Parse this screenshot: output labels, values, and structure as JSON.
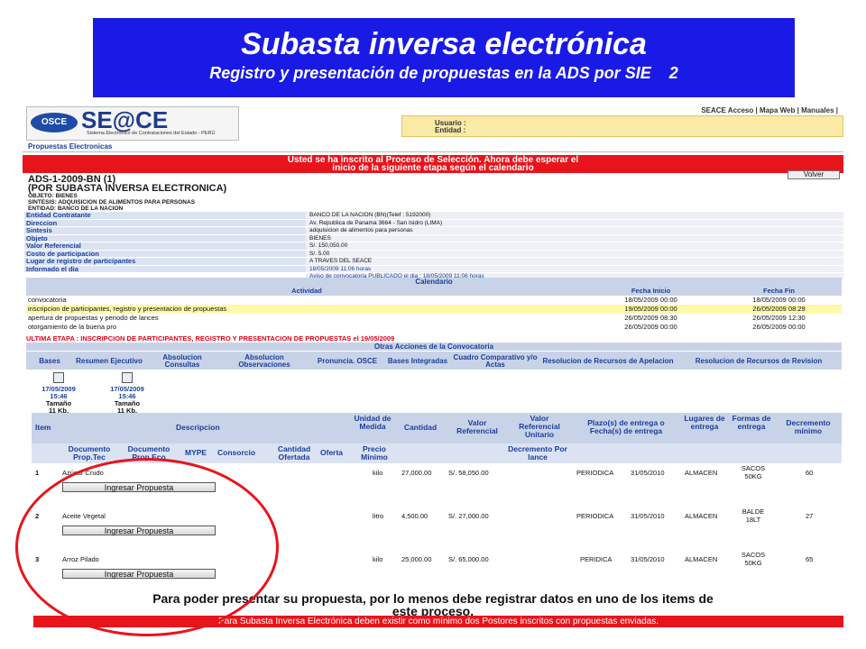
{
  "banner": {
    "title": "Subasta inversa electrónica",
    "subtitle": "Registro y presentación de propuestas en la ADS por SIE",
    "slide_number": "2"
  },
  "app": {
    "logo_badge": "OSCE",
    "brand": "SE@CE",
    "brand_sub": "Sistema Electrónico de Contrataciones del Estado - PERÚ",
    "nav": [
      "SEACE Acceso",
      "Mapa Web",
      "Manuales"
    ],
    "user_label": "Usuario :",
    "entity_label": "Entidad :",
    "tab": "Propuestas Electronicas"
  },
  "alert": {
    "line1": "Usted se ha inscrito al Proceso de Selección. Ahora debe esperar el",
    "line2": "inicio de la siguiente etapa según el calendario"
  },
  "volver": "Volver",
  "process": {
    "code": "ADS-1-2009-BN (1)",
    "type": "(POR SUBASTA INVERSA ELECTRONICA)",
    "objeto": "OBJETO: BIENES",
    "sintesis": "SINTESIS: ADQUISICION DE ALIMENTOS PARA PERSONAS",
    "entidad": "ENTIDAD: BANCO DE LA NACION"
  },
  "info": [
    {
      "k": "Entidad Contratante",
      "v": "BANCO DE LA NACION (BN)(Telef : 5192000)"
    },
    {
      "k": "Direccion",
      "v": "Av. Republica de Panama 3664 - San Isidro (LIMA)"
    },
    {
      "k": "Sintesis",
      "v": "adquisicion de alimentos para personas"
    },
    {
      "k": "Objeto",
      "v": "BIENES"
    },
    {
      "k": "Valor Referencial",
      "v": "S/. 150,050.00"
    },
    {
      "k": "Costo de participacion",
      "v": "S/. 5.00"
    },
    {
      "k": "Lugar de registro de participantes",
      "v": "A TRAVES DEL SEACE"
    },
    {
      "k": "Informado el dia",
      "v": "18/05/2009 11:06 horas"
    },
    {
      "k": "",
      "v": "Aviso de convocatoria PUBLICADO el dia : 18/05/2009 11:06 horas"
    }
  ],
  "calendar": {
    "title": "Calendario",
    "headers": [
      "Actividad",
      "Fecha Inicio",
      "Fecha Fin"
    ],
    "rows": [
      {
        "a": "convocatoria",
        "b": "18/05/2009 00:00",
        "c": "18/05/2009 00:00"
      },
      {
        "a": "inscripcion de participantes, registro y presentacion de propuestas",
        "b": "19/05/2009 00:00",
        "c": "26/05/2009 08:29"
      },
      {
        "a": "apertura de propuestas y periodo de lances",
        "b": "26/05/2009 08:30",
        "c": "26/05/2009 12:30"
      },
      {
        "a": "otorgamiento de la buena pro",
        "b": "26/05/2009 00:00",
        "c": "26/05/2009 00:00"
      }
    ]
  },
  "ultima": "ULTIMA ETAPA : INSCRIPCION DE PARTICIPANTES, REGISTRO Y PRESENTACION DE PROPUESTAS el 19/05/2009",
  "otras": "Otras Acciones de la Convocatoria",
  "acciones": [
    "Bases",
    "Resumen Ejecutivo",
    "Absolucion Consultas",
    "Absolucion Observaciones",
    "Pronuncia. OSCE",
    "Bases Integradas",
    "Cuadro Comparativo y/o Actas",
    "Resolucion de Recursos de Apelacion",
    "Resolucion de Recursos de Revision"
  ],
  "docs": [
    {
      "date": "17/05/2009",
      "time": "15:46",
      "size_label": "Tamaño",
      "size": "11 Kb."
    },
    {
      "date": "17/05/2009",
      "time": "15:46",
      "size_label": "Tamaño",
      "size": "11 Kb."
    }
  ],
  "items": {
    "headers": {
      "item": "Item",
      "descripcion": "Descripcion",
      "unidad": "Unidad de Medida",
      "cantidad": "Cantidad",
      "valor": "Valor Referencial",
      "valor_unit": "Valor Referencial Unitario",
      "plazo": "Plazo(s) de entrega o Fecha(s) de entrega",
      "lugares": "Lugares de entrega",
      "formas": "Formas de entrega",
      "decremento": "Decremento mínimo"
    },
    "subheaders": {
      "doc_tec": "Documento Prop.Tec",
      "doc_eco": "Documento Prop.Eco",
      "mype": "MYPE",
      "consorcio": "Consorcio",
      "cant_ofertada": "Cantidad Ofertada",
      "oferta": "Oferta",
      "precio_min": "Precio Mínimo",
      "decremento_lance": "Decremento Por lance"
    },
    "rows": [
      {
        "n": "1",
        "desc": "Azúcar Crudo",
        "unit": "kilo",
        "qty": "27,000.00",
        "valor": "S/. 58,050.00",
        "plazo": "PERIODICA",
        "fecha": "31/05/2010",
        "lugar": "ALMACEN",
        "forma": "SACOS 50KG",
        "dec": "60",
        "btn": "Ingresar Propuesta"
      },
      {
        "n": "2",
        "desc": "Aceite Vegetal",
        "unit": "litro",
        "qty": "4,500.00",
        "valor": "S/. 27,000.00",
        "plazo": "PERIODICA",
        "fecha": "31/05/2010",
        "lugar": "ALMACEN",
        "forma": "BALDE 18LT",
        "dec": "27",
        "btn": "Ingresar Propuesta"
      },
      {
        "n": "3",
        "desc": "Arroz Pilado",
        "unit": "kilo",
        "qty": "25,000.00",
        "valor": "S/. 65,000.00",
        "plazo": "PERIDICA",
        "fecha": "31/05/2010",
        "lugar": "ALMACEN",
        "forma": "SACOS 50KG",
        "dec": "65",
        "btn": "Ingresar Propuesta"
      }
    ]
  },
  "warning": {
    "line1": "Para poder presentar su propuesta, por lo menos debe registrar datos en uno de los items de",
    "line2": "este proceso."
  },
  "footer": "Para Subasta Inversa Electrónica deben existir como mínimo dos Postores inscritos con propuestas enviadas.",
  "colors": {
    "banner": "#1a1ae6",
    "alert": "#e8141c",
    "header": "#c9d3e8",
    "highlight": "#fff8a8"
  }
}
